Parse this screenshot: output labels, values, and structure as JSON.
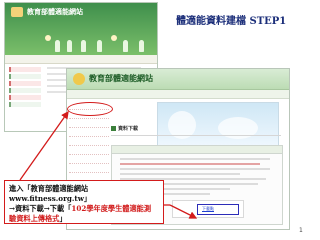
{
  "slide": {
    "title": "體適能資料建檔 STEP1",
    "page_number": "1"
  },
  "back_screenshot": {
    "brand": "教育部體適能網站"
  },
  "front_screenshot": {
    "brand": "教育部體適能網站",
    "section_heading": "資料下載",
    "link_text": "下載點"
  },
  "callout": {
    "line1": "進入「教育部體適能網站www.fitness.org.tw」",
    "line2_prefix": "→資料下載→下載「",
    "line2_red": "102學年度學生體適能測",
    "line3_red": "驗資料上傳格式",
    "line3_suffix": "」"
  },
  "colors": {
    "accent_red": "#d31b1b",
    "title_blue": "#1c2f7a",
    "header_green": "#3f8f4c"
  }
}
